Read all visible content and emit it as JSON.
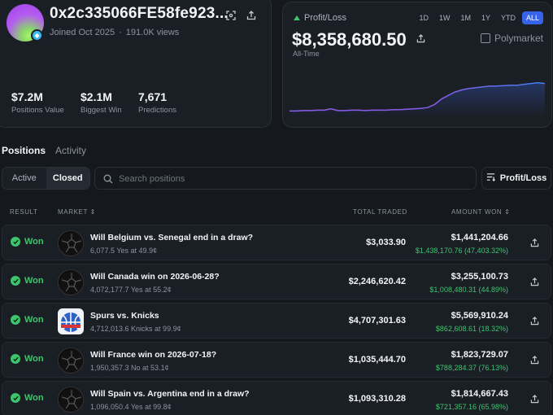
{
  "profile": {
    "address": "0x2c335066FE58fe923...",
    "joined": "Joined Oct 2025",
    "views": "191.0K views",
    "stats": [
      {
        "value": "$7.2M",
        "label": "Positions Value"
      },
      {
        "value": "$2.1M",
        "label": "Biggest Win"
      },
      {
        "value": "7,671",
        "label": "Predictions"
      }
    ]
  },
  "pnl": {
    "label": "Profit/Loss",
    "amount": "$8,358,680.50",
    "period": "All-Time",
    "brand": "Polymarket",
    "ranges": [
      "1D",
      "1W",
      "1M",
      "1Y",
      "YTD",
      "ALL"
    ],
    "active_range": "ALL",
    "trend": [
      0.05,
      0.05,
      0.06,
      0.06,
      0.07,
      0.07,
      0.1,
      0.06,
      0.06,
      0.07,
      0.07,
      0.06,
      0.07,
      0.07,
      0.07,
      0.08,
      0.08,
      0.09,
      0.1,
      0.11,
      0.13,
      0.2,
      0.33,
      0.42,
      0.5,
      0.55,
      0.58,
      0.6,
      0.62,
      0.64,
      0.64,
      0.65,
      0.66,
      0.66,
      0.68,
      0.7,
      0.72,
      0.7
    ]
  },
  "tabs": {
    "positions": "Positions",
    "activity": "Activity"
  },
  "filter": {
    "active": "Active",
    "closed": "Closed"
  },
  "search": {
    "placeholder": "Search positions"
  },
  "sort_label": "Profit/Loss",
  "table": {
    "headers": {
      "result": "RESULT",
      "market": "MARKET",
      "traded": "TOTAL TRADED",
      "amount": "AMOUNT WON"
    },
    "rows": [
      {
        "result": "Won",
        "title": "Will Belgium vs. Senegal end in a draw?",
        "sub": "6,077.5 Yes at 49.9¢",
        "traded": "$3,033.90",
        "amount": "$1,441,204.66",
        "gain": "$1,438,170.76 (47,403.32%)",
        "image": "ball"
      },
      {
        "result": "Won",
        "title": "Will Canada win on 2026-06-28?",
        "sub": "4,072,177.7 Yes at 55.2¢",
        "traded": "$2,246,620.42",
        "amount": "$3,255,100.73",
        "gain": "$1,008,480.31 (44.89%)",
        "image": "ball"
      },
      {
        "result": "Won",
        "title": "Spurs vs. Knicks",
        "sub": "4,712,013.6 Knicks at 99.9¢",
        "traded": "$4,707,301.63",
        "amount": "$5,569,910.24",
        "gain": "$862,608.61 (18.32%)",
        "image": "nba"
      },
      {
        "result": "Won",
        "title": "Will France win on 2026-07-18?",
        "sub": "1,950,357.3 No at 53.1¢",
        "traded": "$1,035,444.70",
        "amount": "$1,823,729.07",
        "gain": "$788,284.37 (76.13%)",
        "image": "ball"
      },
      {
        "result": "Won",
        "title": "Will Spain vs. Argentina end in a draw?",
        "sub": "1,096,050.4 Yes at 99.8¢",
        "traded": "$1,093,310.28",
        "amount": "$1,814,667.43",
        "gain": "$721,357.16 (65.98%)",
        "image": "ball"
      }
    ]
  }
}
